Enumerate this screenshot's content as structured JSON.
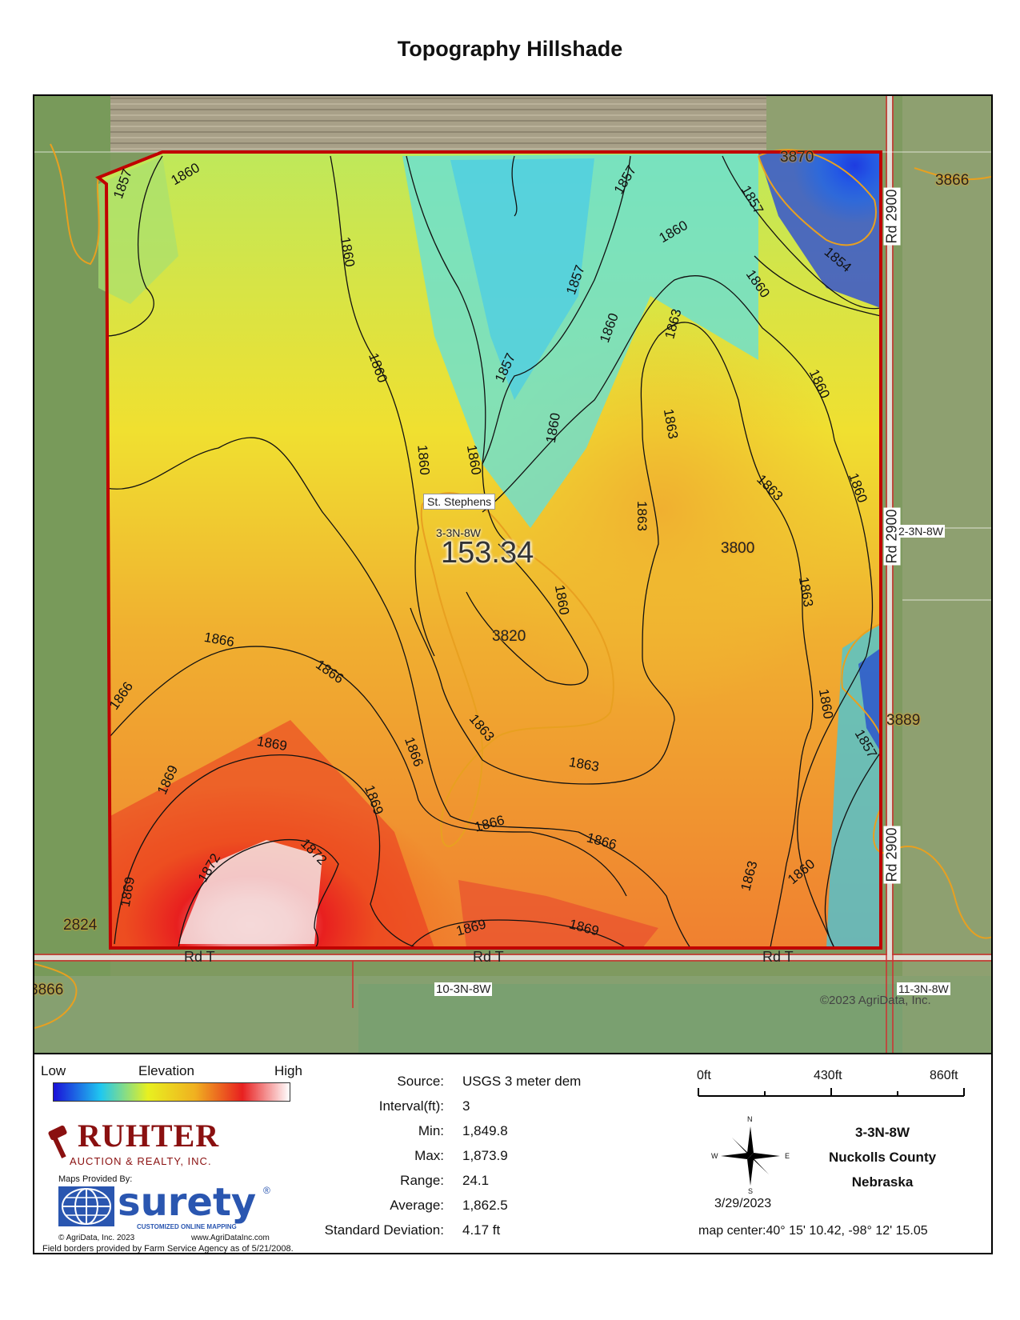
{
  "title": "Topography Hillshade",
  "map": {
    "center_label": "St. Stephens",
    "section_label": "3-3N-8W",
    "acreage": "153.34",
    "copyright": "©2023 AgriData, Inc.",
    "roads": {
      "north_east": "Rd 2900",
      "south": "Rd T"
    },
    "neighbor_sections": {
      "east": "2-3N-8W",
      "south": "10-3N-8W",
      "southeast": "11-3N-8W"
    },
    "soil_labels": [
      "3870",
      "3866",
      "3800",
      "3820",
      "3889",
      "2824",
      "3866"
    ],
    "contour_labels": [
      "1857",
      "1860",
      "1860",
      "1860",
      "1857",
      "1857",
      "1860",
      "1860",
      "1857",
      "1860",
      "1857",
      "1854",
      "1860",
      "1863",
      "1863",
      "1860",
      "1863",
      "1863",
      "1863",
      "1860",
      "1866",
      "1866",
      "1866",
      "1869",
      "1869",
      "1869",
      "1872",
      "1872",
      "1869",
      "1869",
      "1869",
      "1866",
      "1866",
      "1866",
      "1863",
      "1863",
      "1860",
      "1857",
      "1860",
      "1863",
      "1860",
      "1860",
      "1860"
    ],
    "colors": {
      "boundary": "#c00000",
      "contour": "#111111",
      "soil_line": "#e8a020"
    }
  },
  "legend": {
    "low": "Low",
    "elevation": "Elevation",
    "high": "High",
    "ramp_colors": [
      "#1a10d8",
      "#20c8f0",
      "#e8f020",
      "#f0b020",
      "#e82020",
      "#ffffff"
    ]
  },
  "stats": [
    {
      "label": "Source:",
      "value": "USGS 3 meter dem"
    },
    {
      "label": "Interval(ft):",
      "value": "3"
    },
    {
      "label": "Min:",
      "value": "1,849.8"
    },
    {
      "label": "Max:",
      "value": "1,873.9"
    },
    {
      "label": "Range:",
      "value": "24.1"
    },
    {
      "label": "Average:",
      "value": "1,862.5"
    },
    {
      "label": "Standard Deviation:",
      "value": "4.17 ft"
    }
  ],
  "scale": {
    "labels": [
      "0ft",
      "430ft",
      "860ft"
    ]
  },
  "compass": {
    "n": "N",
    "s": "S",
    "e": "E",
    "w": "W"
  },
  "date": "3/29/2023",
  "location": {
    "section": "3-3N-8W",
    "county": "Nuckolls County",
    "state": "Nebraska"
  },
  "map_center": "map center:40° 15' 10.42,  -98° 12' 15.05",
  "branding": {
    "ruhter": "RUHTER",
    "ruhter_sub": "AUCTION & REALTY, INC.",
    "maps_provided": "Maps Provided By:",
    "surety": "surety",
    "surety_reg": "®",
    "surety_sub": "CUSTOMIZED ONLINE MAPPING",
    "agridata_copy": "© AgriData, Inc. 2023",
    "agridata_url": "www.AgriDataInc.com",
    "field_borders": "Field borders provided by Farm Service Agency as of 5/21/2008."
  }
}
